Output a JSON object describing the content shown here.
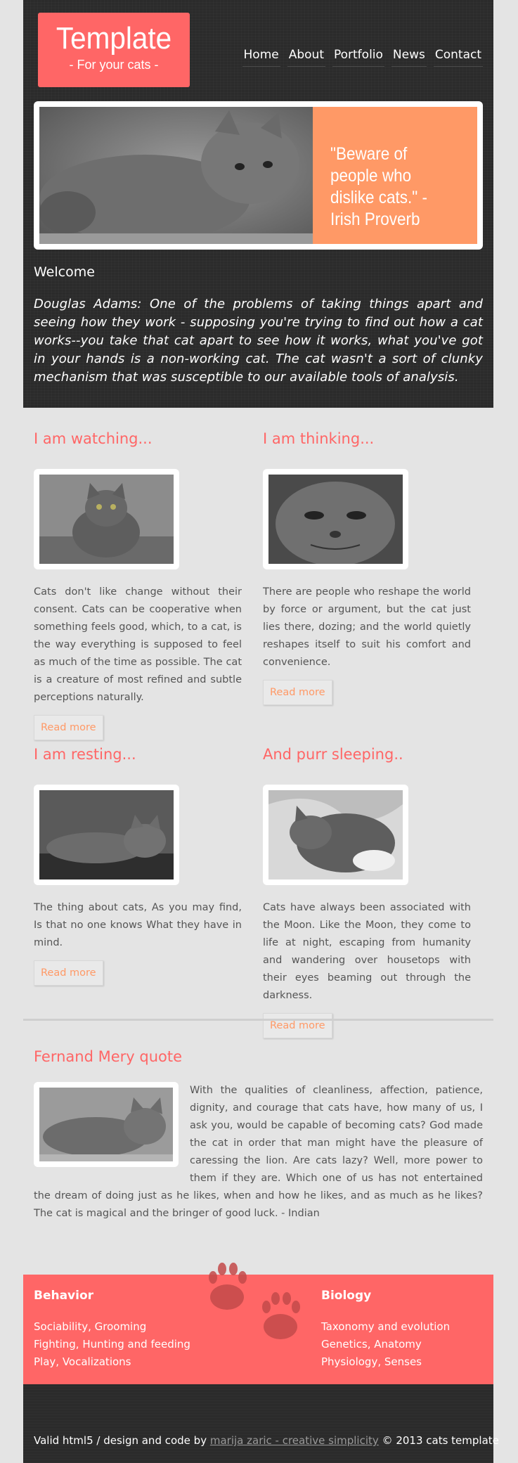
{
  "logo": {
    "title": "Template",
    "subtitle": "- For your cats -"
  },
  "nav": [
    "Home",
    "About",
    "Portfolio",
    "News",
    "Contact"
  ],
  "banner": {
    "quote": "\"Beware of people who dislike cats.\" - Irish Proverb"
  },
  "welcome": {
    "heading": "Welcome",
    "text": "Douglas Adams: One of the problems of taking things apart and seeing how they work - supposing you're trying to find out how a cat works--you take that cat apart to see how it works, what you've got in your hands is a non-working cat. The cat wasn't a sort of clunky mechanism that was susceptible to our available tools of analysis."
  },
  "articles": [
    {
      "title": "I am watching...",
      "text": "Cats don't like change without their consent. Cats can be cooperative when something feels good, which, to a cat, is the way everything is supposed to feel as much of the time as possible. The cat is a creature of most refined and subtle perceptions naturally.",
      "button": "Read more"
    },
    {
      "title": "I am thinking...",
      "text": "There are people who reshape the world by force or argument, but the cat just lies there, dozing; and the world quietly reshapes itself to suit his comfort and convenience.",
      "button": "Read more"
    },
    {
      "title": "I am resting...",
      "text": "The thing about cats, As you may find, Is that no one knows What they have in mind.",
      "button": "Read more"
    },
    {
      "title": "And purr sleeping..",
      "text": "Cats have always been associated with the Moon. Like the Moon, they come to life at night, escaping from humanity and wandering over housetops with their eyes beaming out through the darkness.",
      "button": "Read more"
    }
  ],
  "quote_section": {
    "title": "Fernand Mery quote",
    "text": "With the qualities of cleanliness, affection, patience, dignity, and courage that cats have, how many of us, I ask you, would be capable of becoming cats? God made the cat in order that man might have the pleasure of caressing the lion. Are cats lazy? Well, more power to them if they are. Which one of us has not entertained the dream of doing just as he likes, when and how he likes, and as much as he likes? The cat is magical and the bringer of good luck. - Indian"
  },
  "footer": {
    "behavior": {
      "title": "Behavior",
      "items": [
        "Sociability, Grooming",
        "Fighting, Hunting and feeding",
        "Play, Vocalizations"
      ]
    },
    "biology": {
      "title": "Biology",
      "items": [
        "Taxonomy and evolution",
        "Genetics, Anatomy",
        "Physiology, Senses"
      ]
    },
    "credits_prefix": "Valid html5 / design and code by",
    "credits_link": "marija zaric - creative simplicity",
    "credits_suffix": "© 2013 cats template"
  },
  "colors": {
    "accent": "#ff6666",
    "orange": "#ff9966",
    "dark": "#2b2b2b",
    "page": "#e4e4e4"
  },
  "icons": [
    "paw-print-icon"
  ]
}
